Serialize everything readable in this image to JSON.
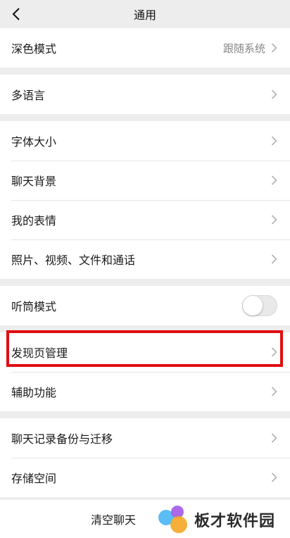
{
  "header": {
    "title": "通用",
    "back_icon": "chevron-left-icon"
  },
  "groups": [
    {
      "items": [
        {
          "label": "深色模式",
          "value": "跟随系统"
        }
      ]
    },
    {
      "items": [
        {
          "label": "多语言"
        }
      ]
    },
    {
      "items": [
        {
          "label": "字体大小"
        },
        {
          "label": "聊天背景"
        },
        {
          "label": "我的表情"
        },
        {
          "label": "照片、视频、文件和通话"
        }
      ]
    },
    {
      "items": [
        {
          "label": "听筒模式",
          "toggle": false
        }
      ]
    },
    {
      "items": [
        {
          "label": "发现页管理"
        },
        {
          "label": "辅助功能"
        }
      ]
    },
    {
      "items": [
        {
          "label": "聊天记录备份与迁移"
        },
        {
          "label": "存储空间"
        }
      ]
    }
  ],
  "bottom": {
    "clear_label": "清空聊天"
  },
  "watermark": {
    "text": "板才软件园"
  },
  "colors": {
    "highlight": "#e10d10",
    "background": "#ededed"
  }
}
